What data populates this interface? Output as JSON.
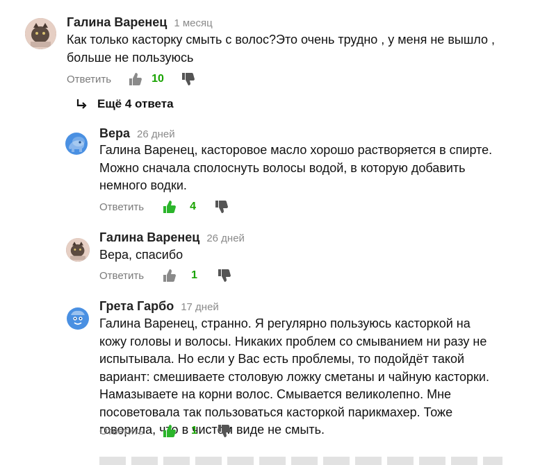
{
  "comments": [
    {
      "author": "Галина Варенец",
      "time": "1 месяц",
      "lines": [
        "Как только касторку смыть с волос?Это очень трудно , у меня не вышло ,",
        "больше не пользуюсь"
      ],
      "reply_label": "Ответить",
      "likes": "10",
      "liked": false,
      "avatar": "photo"
    },
    {
      "author": "Вера",
      "time": "26 дней",
      "lines": [
        "Галина Варенец, касторовое масло хорошо растворяется в спирте.",
        "Можно сначала сполоснуть волосы водой, в которую добавить",
        "немного водки."
      ],
      "reply_label": "Ответить",
      "likes": "4",
      "liked": true,
      "avatar": "blue-elephant"
    },
    {
      "author": "Галина Варенец",
      "time": "26 дней",
      "lines": [
        "Вера, спасибо"
      ],
      "reply_label": "Ответить",
      "likes": "1",
      "liked": false,
      "avatar": "photo"
    },
    {
      "author": "Грета Гарбо",
      "time": "17 дней",
      "lines": [
        "Галина Варенец, странно. Я регулярно пользуюсь касторкой на",
        "кожу головы и волосы. Никаких проблем со смыванием ни разу не",
        "испытывала. Но если у Вас есть проблемы, то подойдёт такой",
        "вариант: смешиваете столовую ложку сметаны и чайную касторки.",
        "Намазываете на корни волос. Смывается великолепно. Мне",
        "посоветовала так пользоваться касторкой парикмахер. Тоже",
        "говорила, что в чистом виде не смыть."
      ],
      "reply_label": "Ответить",
      "likes": "1",
      "liked": true,
      "avatar": "blue-cookie"
    }
  ],
  "more_replies": {
    "label": "Ещё 4 ответа",
    "icon": "reply-arrow-icon"
  },
  "colors": {
    "like_active": "#2bb52b",
    "count": "#19a300",
    "muted": "#7a7a7a",
    "avatar_blue": "#4a90e2"
  }
}
